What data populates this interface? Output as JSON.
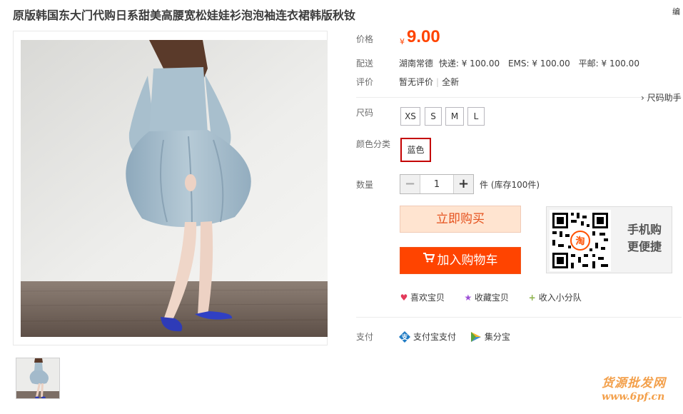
{
  "product": {
    "title": "原版韩国东大门代购日系甜美高腰宽松娃娃衫泡泡袖连衣裙韩版秋钕",
    "edge_text": "编",
    "image_subject": "woman in light blue babydoll dress, blue flats, white wall, wooden floor"
  },
  "labels": {
    "price": "价格",
    "shipping": "配送",
    "review": "评价",
    "size": "尺码",
    "color": "颜色分类",
    "quantity": "数量",
    "payment": "支付"
  },
  "price": {
    "currency": "¥",
    "value": "9.00"
  },
  "shipping": {
    "location": "湖南常德",
    "express": "快递: ¥ 100.00",
    "ems": "EMS: ¥ 100.00",
    "mail": "平邮: ¥ 100.00"
  },
  "review": {
    "status": "暂无评价",
    "condition": "全新"
  },
  "size_help": "› 尺码助手",
  "sizes": [
    "XS",
    "S",
    "M",
    "L"
  ],
  "colors": [
    {
      "label": "蓝色",
      "selected": true
    }
  ],
  "quantity": {
    "minus": "−",
    "value": "1",
    "plus": "+",
    "stock": "件 (库存100件)"
  },
  "buttons": {
    "buy_now": "立即购买",
    "add_to_cart": "加入购物车"
  },
  "qr": {
    "text_line1": "手机购",
    "text_line2": "更便捷",
    "center_char": "淘"
  },
  "actions": {
    "favorite": "喜欢宝贝",
    "collect": "收藏宝贝",
    "join": "收入小分队"
  },
  "payment": {
    "alipay": "支付宝支付",
    "jifenbao": "集分宝"
  },
  "watermark": {
    "line1": "货源批发网",
    "line2": "www.6pf.cn"
  },
  "colors_theme": {
    "price": "#ff4400",
    "cart_button": "#ff4400",
    "buy_button_bg": "#ffe4d0",
    "selected_border": "#c40000",
    "watermark": "#f3a04b"
  }
}
